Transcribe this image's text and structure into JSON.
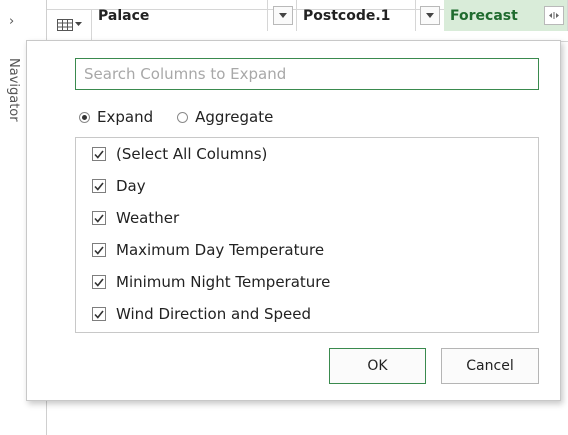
{
  "navigator": {
    "chevron": "›",
    "label": "Navigator"
  },
  "header": {
    "columns": [
      {
        "label": "Palace"
      },
      {
        "label": "Postcode.1"
      },
      {
        "label": "Forecast"
      }
    ],
    "icons": {
      "table": "table-icon",
      "dropdown": "chevron-down-icon",
      "expand": "expand-columns-icon"
    }
  },
  "dialog": {
    "search": {
      "value": "",
      "placeholder": "Search Columns to Expand"
    },
    "mode": {
      "options": [
        "Expand",
        "Aggregate"
      ],
      "selected": "Expand"
    },
    "columns": [
      {
        "label": "(Select All Columns)",
        "checked": true
      },
      {
        "label": "Day",
        "checked": true
      },
      {
        "label": "Weather",
        "checked": true
      },
      {
        "label": "Maximum Day Temperature",
        "checked": true
      },
      {
        "label": "Minimum Night Temperature",
        "checked": true
      },
      {
        "label": "Wind Direction and Speed",
        "checked": true
      }
    ],
    "ok_label": "OK",
    "cancel_label": "Cancel"
  },
  "colors": {
    "accent": "#3a8a4e",
    "forecast_header_bg": "#d9ecd9"
  }
}
